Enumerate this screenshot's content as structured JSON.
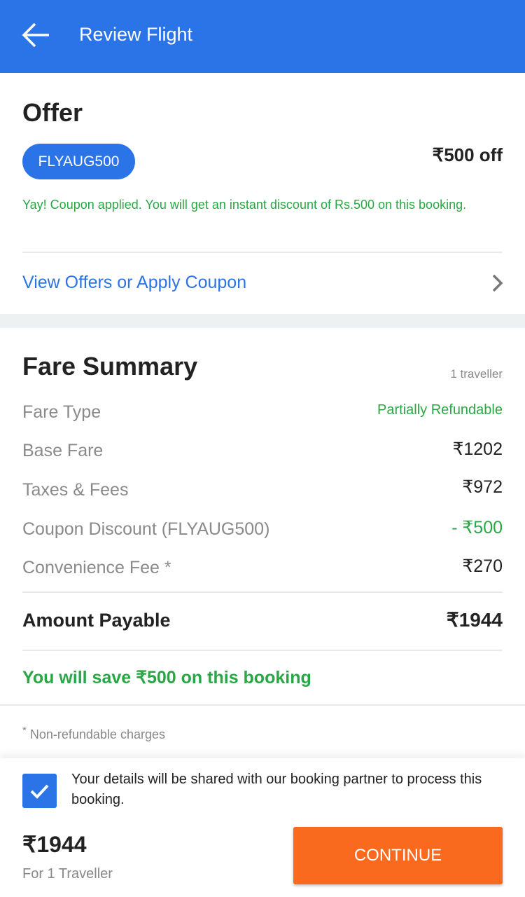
{
  "header": {
    "title": "Review Flight",
    "back_icon": "arrow-left-icon"
  },
  "offer": {
    "heading": "Offer",
    "coupon_code": "FLYAUG500",
    "discount_label": "₹500 off",
    "message": "Yay! Coupon applied. You will get an instant discount of Rs.500 on this booking.",
    "view_offers_link": "View Offers or Apply Coupon"
  },
  "fare": {
    "heading": "Fare Summary",
    "travellers": "1 traveller",
    "rows": [
      {
        "label": "Fare Type",
        "value": "Partially Refundable"
      },
      {
        "label": "Base Fare",
        "value": "₹1202"
      },
      {
        "label": "Taxes & Fees",
        "value": "₹972"
      },
      {
        "label": "Coupon Discount (FLYAUG500)",
        "value": "- ₹500"
      },
      {
        "label": "Convenience Fee *",
        "value": "₹270"
      }
    ],
    "total_label": "Amount Payable",
    "total_value": "₹1944",
    "savings": "You will save ₹500 on this booking",
    "footnote_mark": "*",
    "footnote": "Non-refundable charges"
  },
  "footer": {
    "consent_checked": true,
    "consent_text": "Your details will be shared with our booking partner to process this booking.",
    "price": "₹1944",
    "price_sub": "For 1 Traveller",
    "continue_label": "CONTINUE"
  },
  "colors": {
    "primary": "#2b74e8",
    "accent": "#fa6a1e",
    "success": "#2aa745"
  }
}
